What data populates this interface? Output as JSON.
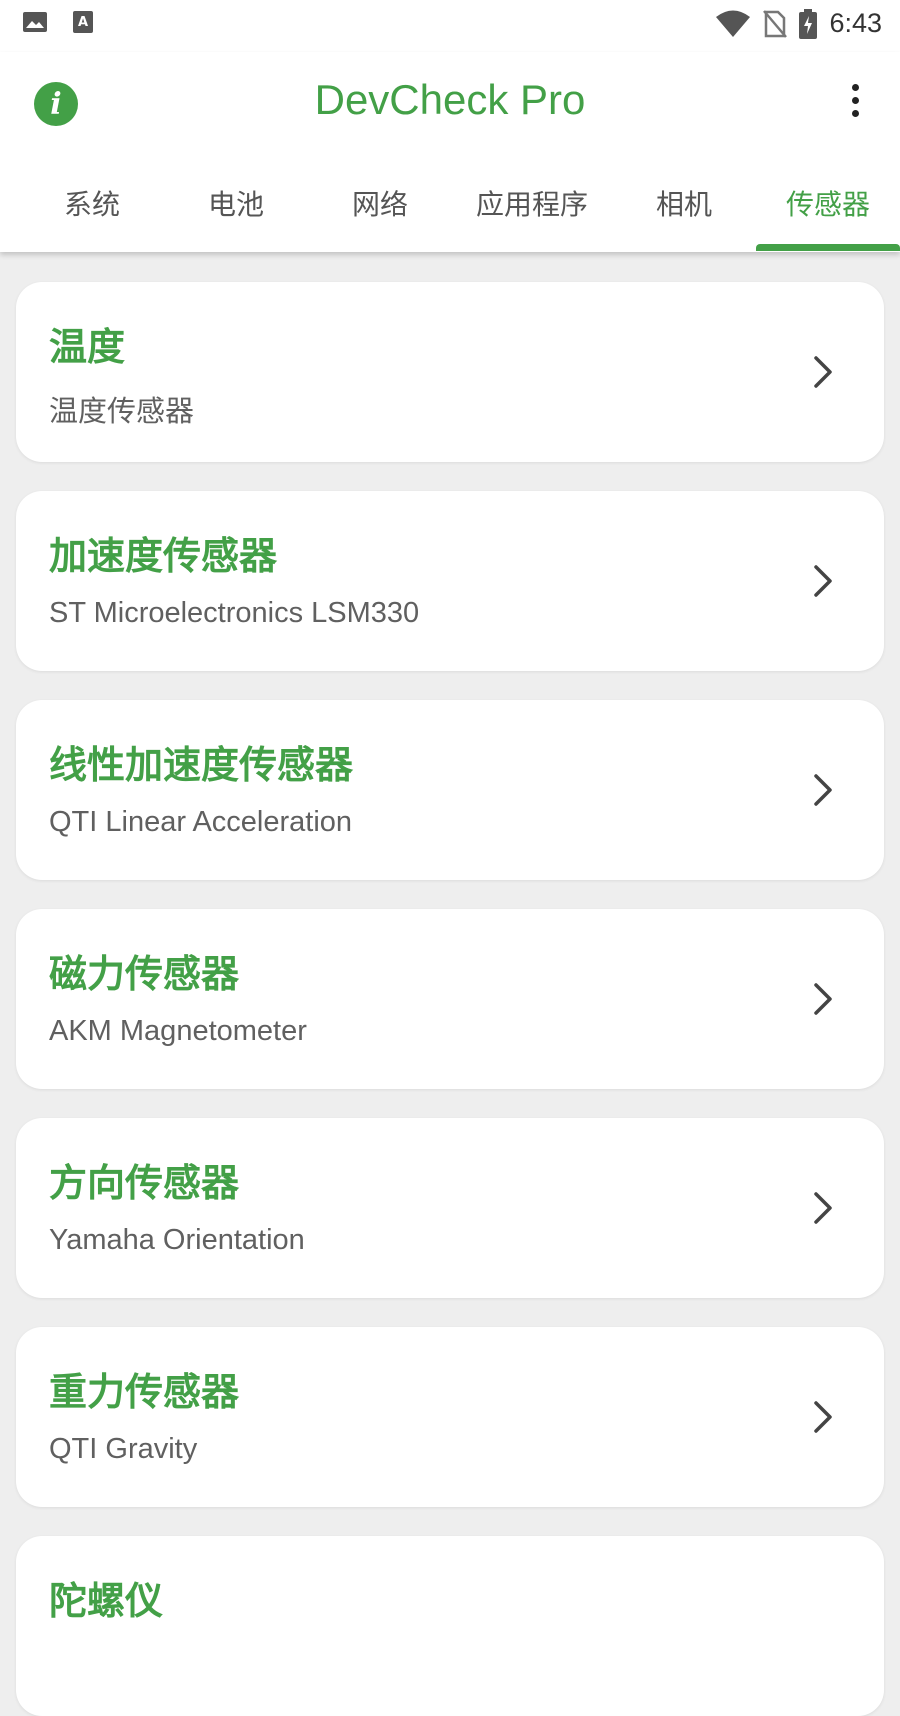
{
  "status_bar": {
    "time": "6:43",
    "icons": [
      "gallery-icon",
      "keyboard-icon",
      "wifi-icon",
      "no-sim-icon",
      "battery-charging-icon"
    ]
  },
  "app_bar": {
    "title": "DevCheck Pro",
    "info_icon": "info-icon",
    "menu_icon": "more-vert-icon"
  },
  "tabs": [
    {
      "label": "系统"
    },
    {
      "label": "电池"
    },
    {
      "label": "网络"
    },
    {
      "label": "应用程序"
    },
    {
      "label": "相机"
    },
    {
      "label": "传感器",
      "active": true
    }
  ],
  "sensors": [
    {
      "title": "温度",
      "subtitle": "温度传感器"
    },
    {
      "title": "加速度传感器",
      "subtitle": "ST Microelectronics LSM330"
    },
    {
      "title": "线性加速度传感器",
      "subtitle": "QTI Linear Acceleration"
    },
    {
      "title": "磁力传感器",
      "subtitle": "AKM Magnetometer"
    },
    {
      "title": "方向传感器",
      "subtitle": "Yamaha Orientation"
    },
    {
      "title": "重力传感器",
      "subtitle": "QTI Gravity"
    },
    {
      "title": "陀螺仪",
      "subtitle": ""
    }
  ],
  "colors": {
    "accent": "#43a047",
    "background": "#eeeeee",
    "card": "#ffffff",
    "subtitle_text": "#606060"
  }
}
